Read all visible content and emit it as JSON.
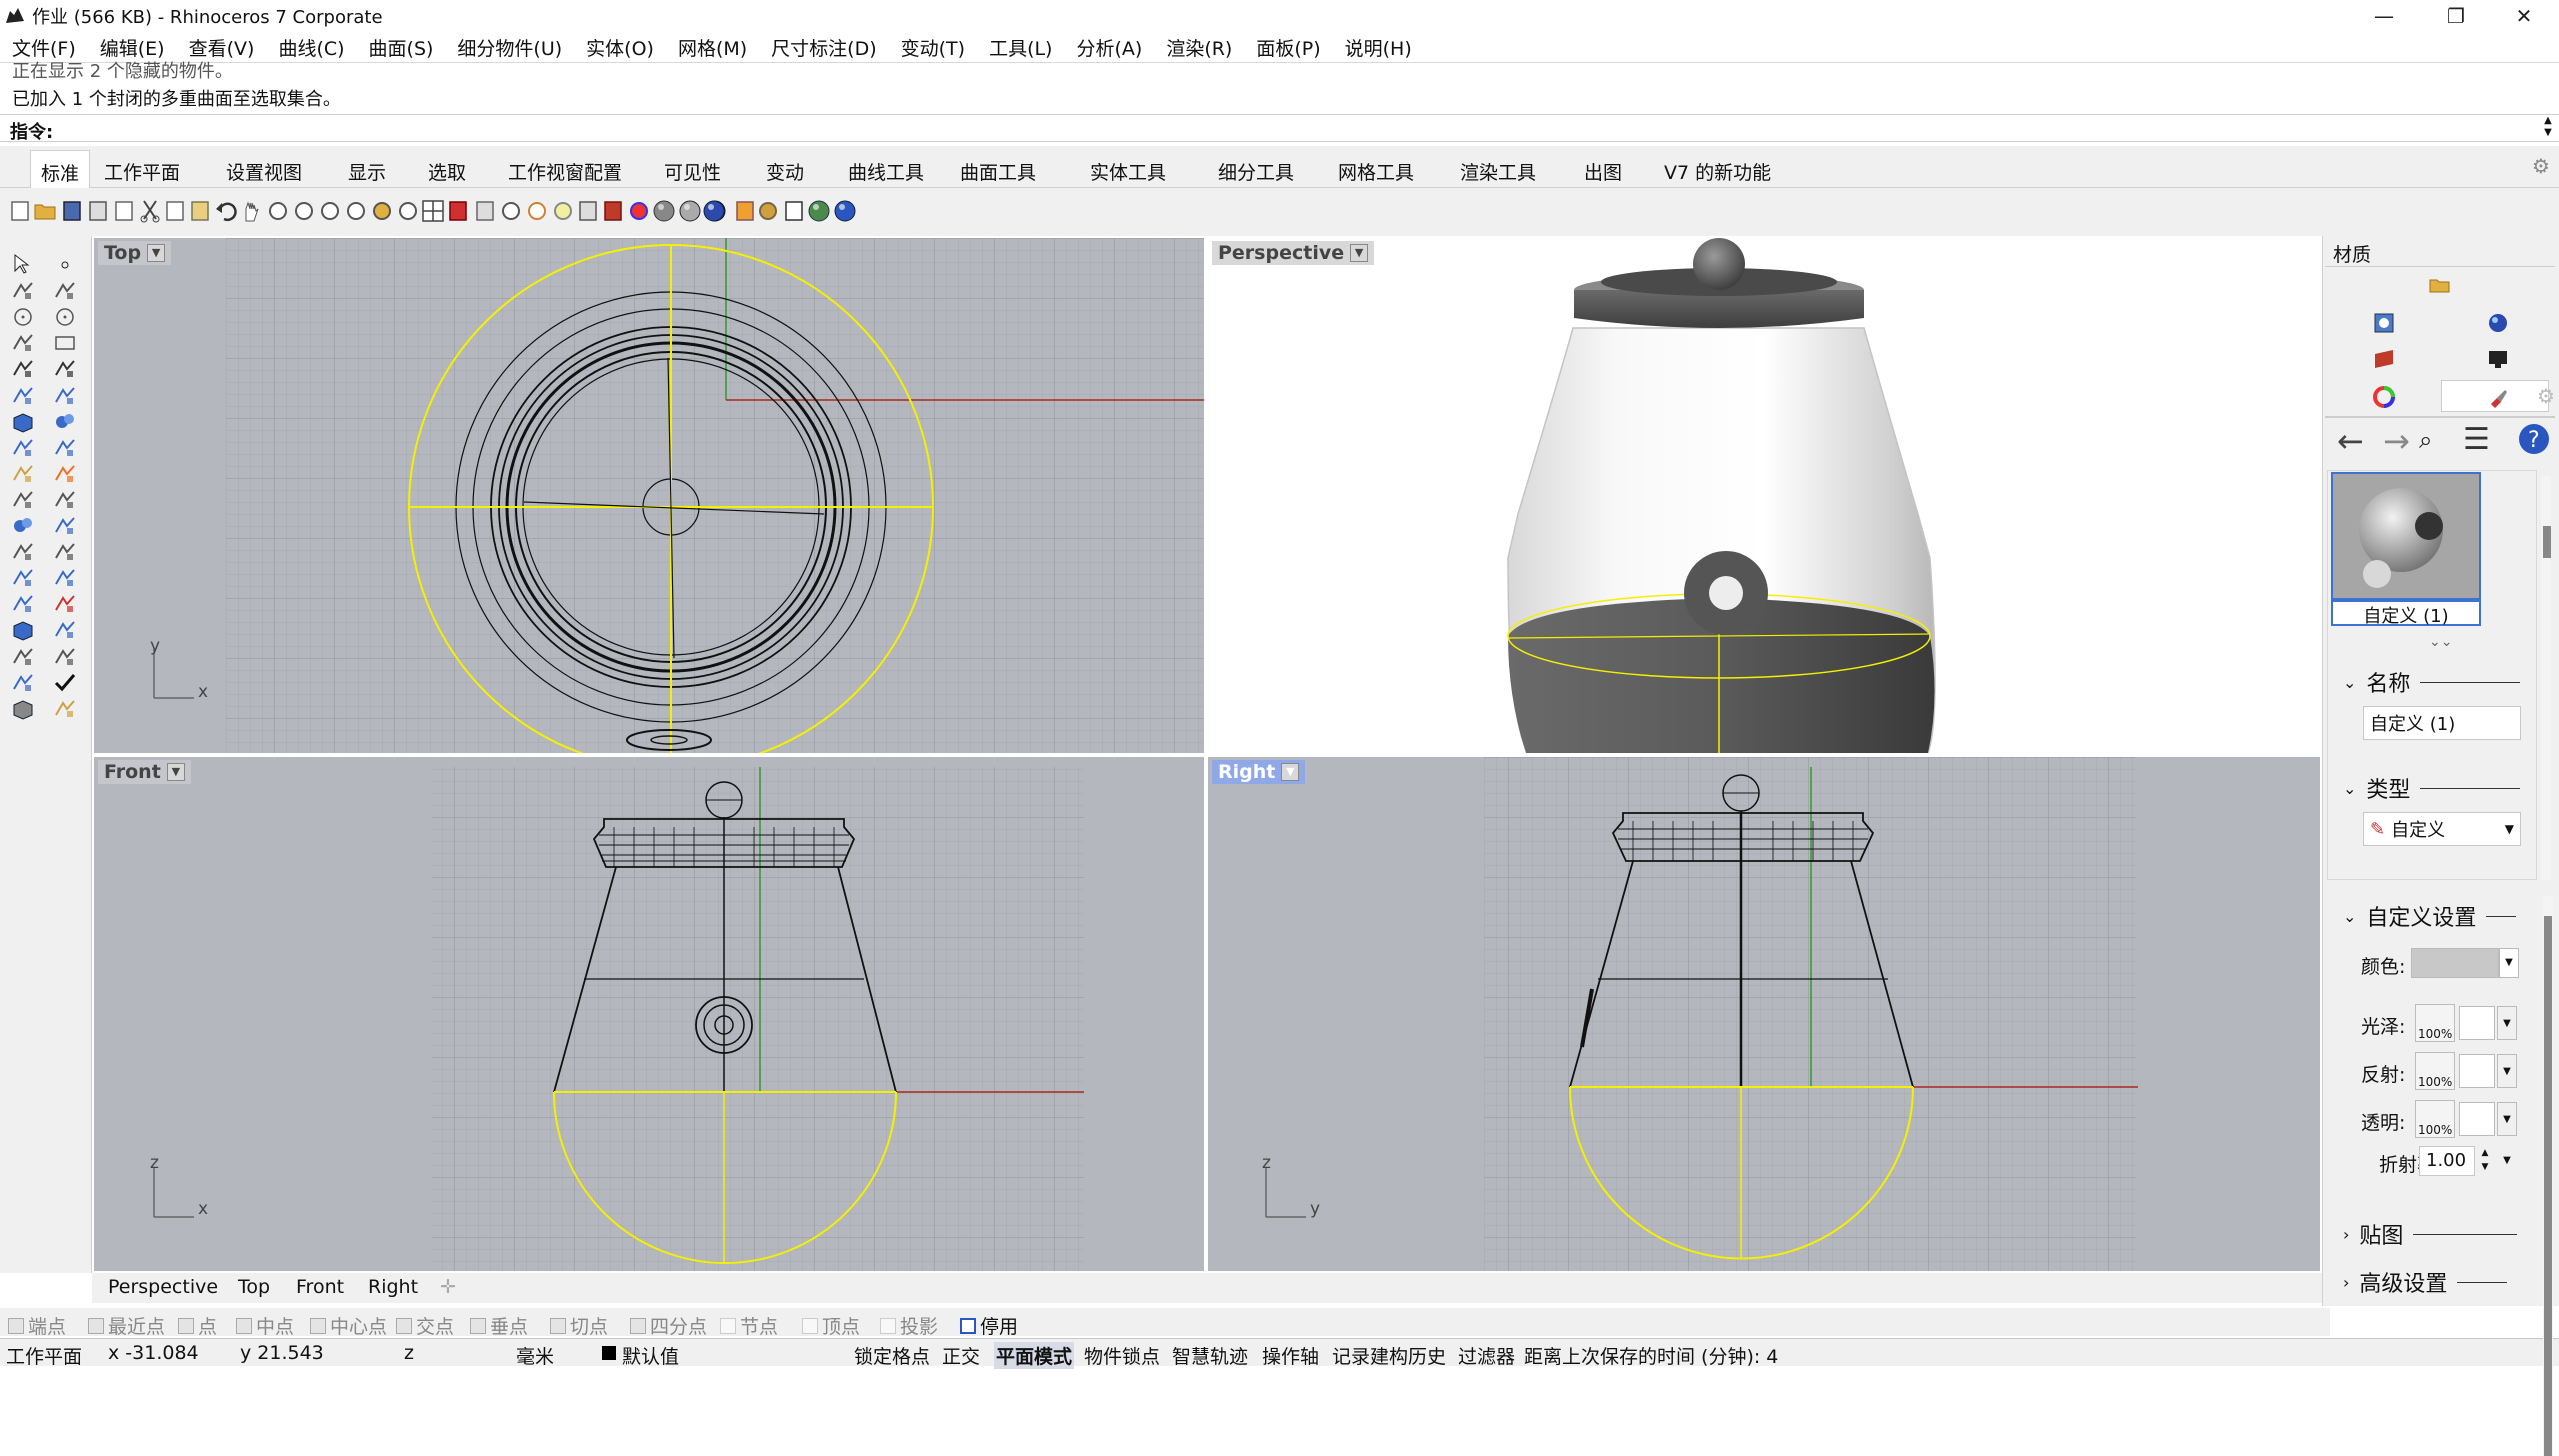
{
  "window": {
    "title": "作业 (566 KB) - Rhinoceros 7 Corporate",
    "minimize": "—",
    "maximize": "❐",
    "close": "✕"
  },
  "menu": [
    "文件(F)",
    "编辑(E)",
    "查看(V)",
    "曲线(C)",
    "曲面(S)",
    "细分物件(U)",
    "实体(O)",
    "网格(M)",
    "尺寸标注(D)",
    "变动(T)",
    "工具(L)",
    "分析(A)",
    "渲染(R)",
    "面板(P)",
    "说明(H)"
  ],
  "command": {
    "history": [
      "正在显示 2 个隐藏的物件。",
      "已加入 1 个封闭的多重曲面至选取集合。"
    ],
    "prompt": "指令:"
  },
  "tabs": [
    "标准",
    "工作平面",
    "设置视图",
    "显示",
    "选取",
    "工作视窗配置",
    "可见性",
    "变动",
    "曲线工具",
    "曲面工具",
    "实体工具",
    "细分工具",
    "网格工具",
    "渲染工具",
    "出图",
    "V7 的新功能"
  ],
  "active_tab": "标准",
  "viewports": {
    "top": "Top",
    "perspective": "Perspective",
    "front": "Front",
    "right": "Right",
    "axes_top": {
      "y": "y",
      "x": "x"
    },
    "axes_front": {
      "z": "z",
      "x": "x"
    },
    "axes_right": {
      "z": "z",
      "y": "y"
    }
  },
  "viewport_tabs": [
    "Perspective",
    "Top",
    "Front",
    "Right"
  ],
  "osnap": [
    {
      "label": "端点"
    },
    {
      "label": "最近点"
    },
    {
      "label": "点"
    },
    {
      "label": "中点"
    },
    {
      "label": "中心点"
    },
    {
      "label": "交点"
    },
    {
      "label": "垂点"
    },
    {
      "label": "切点"
    },
    {
      "label": "四分点"
    },
    {
      "label": "节点"
    },
    {
      "label": "顶点"
    },
    {
      "label": "投影"
    },
    {
      "label": "停用"
    }
  ],
  "status": {
    "cplane": "工作平面",
    "x": "x -31.084",
    "y": "y 21.543",
    "z": "z",
    "units": "毫米",
    "layer": "默认值",
    "grid_snap": "锁定格点",
    "ortho": "正交",
    "planar": "平面模式",
    "osnap": "物件锁点",
    "smarttrack": "智慧轨迹",
    "gumball": "操作轴",
    "history": "记录建构历史",
    "filter": "过滤器",
    "autosave": "距离上次保存的时间 (分钟): 4"
  },
  "panel": {
    "title": "材质",
    "material_name": "自定义 (1)",
    "sections": {
      "name": "名称",
      "type": "类型",
      "custom": "自定义设置",
      "texture": "贴图",
      "advanced": "高级设置"
    },
    "name_value": "自定义 (1)",
    "type_value": "自定义",
    "labels": {
      "color": "颜色:",
      "gloss": "光泽:",
      "reflect": "反射:",
      "transp": "透明:",
      "ior": "折射率"
    },
    "pct": "100%",
    "ior_value": "1.00"
  },
  "colors": {
    "select_yellow": "#f4f000",
    "viewport_bg": "#b4b7bd",
    "grid": "#a6a9ae",
    "xaxis": "#a8281e",
    "yaxis": "#2e9a2e"
  }
}
